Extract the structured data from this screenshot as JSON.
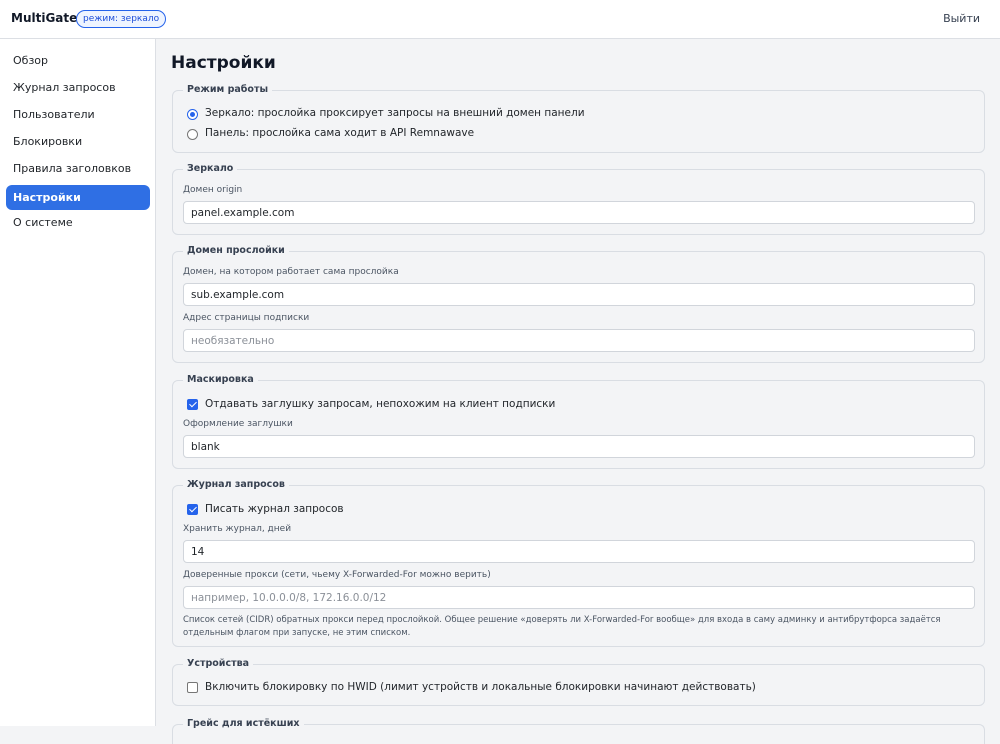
{
  "header": {
    "brand": "MultiGate",
    "mode_badge": "режим: зеркало",
    "logout_label": "Выйти"
  },
  "sidebar": {
    "items": [
      {
        "label": "Обзор",
        "active": false
      },
      {
        "label": "Журнал запросов",
        "active": false
      },
      {
        "label": "Пользователи",
        "active": false
      },
      {
        "label": "Блокировки",
        "active": false
      },
      {
        "label": "Правила заголовков",
        "active": false
      },
      {
        "label": "Настройки",
        "active": true
      },
      {
        "label": "О системе",
        "active": false
      }
    ]
  },
  "page": {
    "title": "Настройки"
  },
  "mode_section": {
    "legend": "Режим работы",
    "options": [
      {
        "label": "Зеркало: прослойка проксирует запросы на внешний домен панели",
        "checked": true
      },
      {
        "label": "Панель: прослойка сама ходит в API Remnawave",
        "checked": false
      }
    ]
  },
  "mirror_section": {
    "legend": "Зеркало",
    "origin_label": "Домен origin",
    "origin_value": "panel.example.com"
  },
  "proxy_domain_section": {
    "legend": "Домен прослойки",
    "domain_label": "Домен, на котором работает сама прослойка",
    "domain_value": "sub.example.com",
    "sub_page_label": "Адрес страницы подписки",
    "sub_page_placeholder": "необязательно"
  },
  "masking_section": {
    "legend": "Маскировка",
    "stub_checkbox_label": "Отдавать заглушку запросам, непохожим на клиент подписки",
    "stub_checked": true,
    "stub_style_label": "Оформление заглушки",
    "stub_style_value": "blank"
  },
  "log_section": {
    "legend": "Журнал запросов",
    "write_log_label": "Писать журнал запросов",
    "write_log_checked": true,
    "retention_label": "Хранить журнал, дней",
    "retention_value": "14",
    "trusted_proxies_label": "Доверенные прокси (сети, чьему X-Forwarded-For можно верить)",
    "trusted_proxies_placeholder": "например, 10.0.0.0/8, 172.16.0.0/12",
    "trusted_proxies_hint": "Список сетей (CIDR) обратных прокси перед прослойкой. Общее решение «доверять ли X-Forwarded-For вообще» для входа в саму админку и антибрутфорса задаётся отдельным флагом при запуске, не этим списком."
  },
  "devices_section": {
    "legend": "Устройства",
    "hwid_label": "Включить блокировку по HWID (лимит устройств и локальные блокировки начинают действовать)",
    "hwid_checked": false
  },
  "grace_section": {
    "legend": "Грейс для истёкших"
  }
}
